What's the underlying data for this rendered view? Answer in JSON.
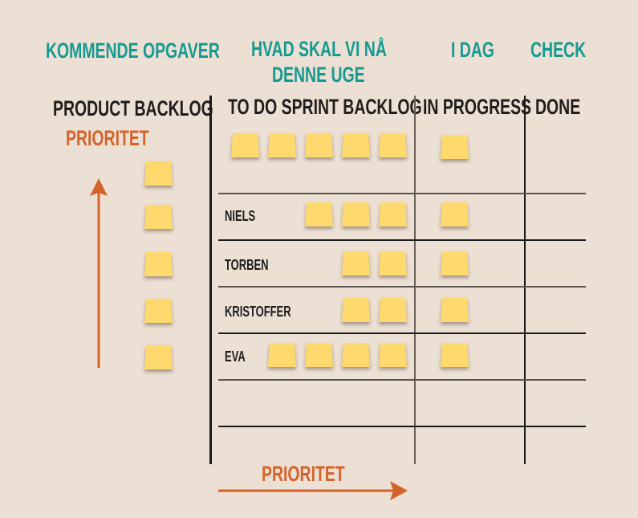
{
  "top_headers": {
    "upcoming": "KOMMENDE OPGAVER",
    "this_week_line1": "HVAD SKAL VI NÅ",
    "this_week_line2": "DENNE UGE",
    "today": "I DAG",
    "check": "CHECK"
  },
  "columns": {
    "product_backlog": "PRODUCT BACKLOG",
    "sprint_backlog": "TO DO SPRINT BACKLOG",
    "in_progress": "IN PROGRESS",
    "done": "DONE"
  },
  "priority_labels": {
    "vertical": "PRIORITET",
    "horizontal": "PRIORITET"
  },
  "product_backlog_notes": 5,
  "rows": [
    {
      "name": "",
      "todo_notes": 5,
      "in_progress_notes": 1,
      "done_notes": 0
    },
    {
      "name": "NIELS",
      "todo_notes": 3,
      "in_progress_notes": 1,
      "done_notes": 0
    },
    {
      "name": "TORBEN",
      "todo_notes": 2,
      "in_progress_notes": 1,
      "done_notes": 0
    },
    {
      "name": "KRISTOFFER",
      "todo_notes": 2,
      "in_progress_notes": 1,
      "done_notes": 0
    },
    {
      "name": "EVA",
      "todo_notes": 4,
      "in_progress_notes": 1,
      "done_notes": 0
    },
    {
      "name": "",
      "todo_notes": 0,
      "in_progress_notes": 0,
      "done_notes": 0
    },
    {
      "name": "",
      "todo_notes": 0,
      "in_progress_notes": 0,
      "done_notes": 0
    }
  ],
  "colors": {
    "background": "#ecdfd3",
    "teal": "#159a92",
    "orange": "#d4632b",
    "sticky_note": "#fdd96e",
    "text_dark": "#1f1d1b"
  }
}
